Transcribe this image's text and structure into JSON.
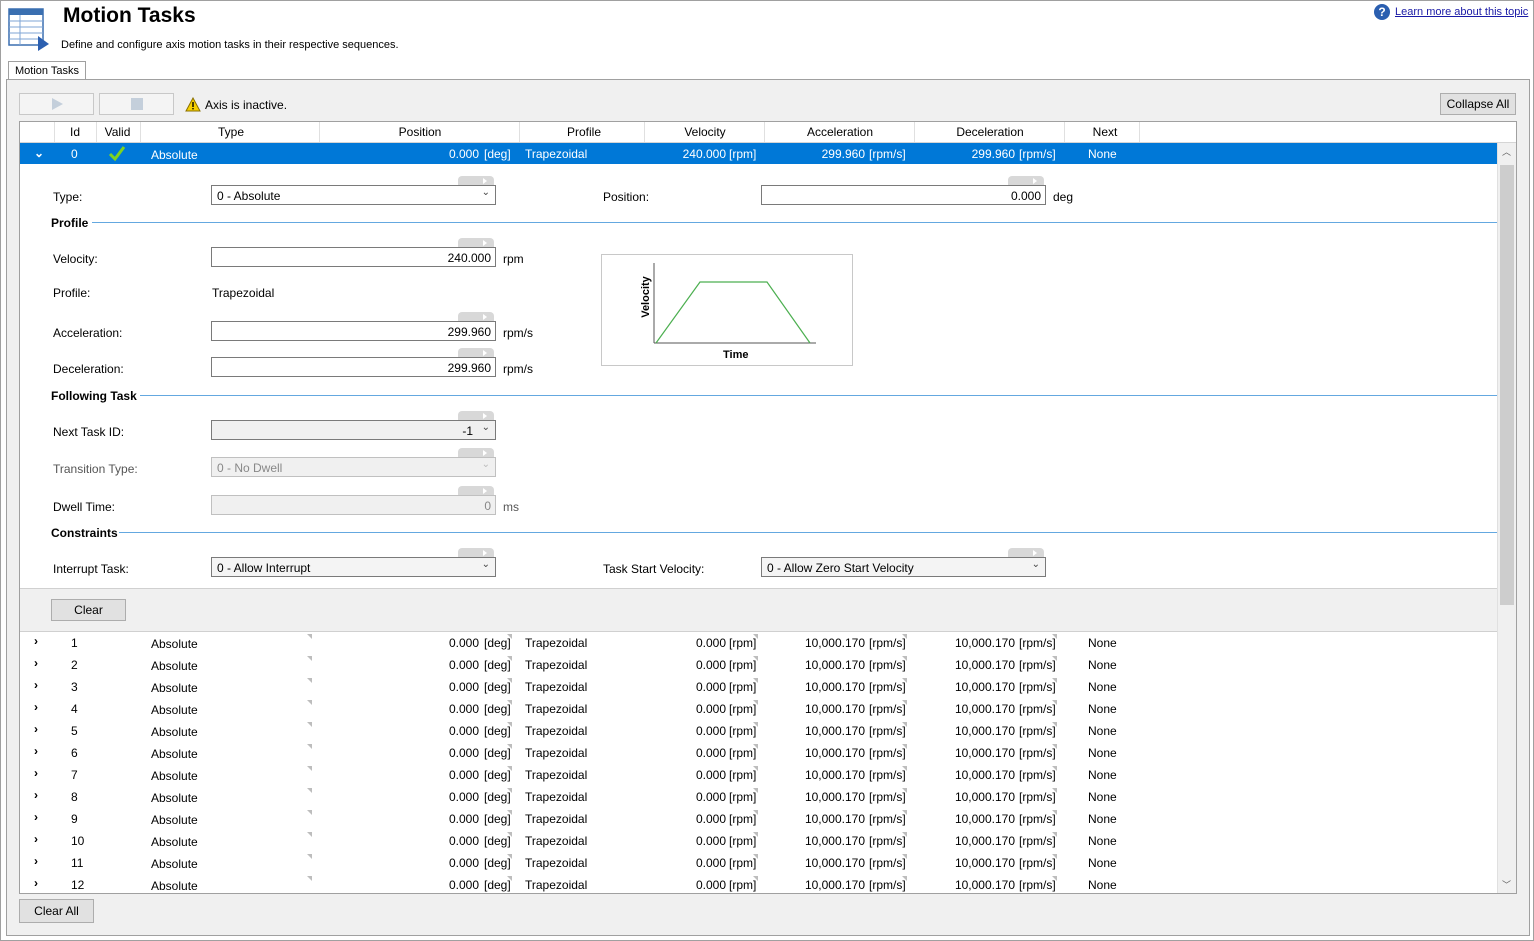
{
  "header": {
    "title": "Motion Tasks",
    "subtitle": "Define and configure axis motion tasks in their respective sequences.",
    "help_link": "Learn more about this topic"
  },
  "tabs": [
    {
      "label": "Motion Tasks"
    }
  ],
  "toolbar": {
    "status_text": "Axis is inactive.",
    "collapse_label": "Collapse All"
  },
  "grid": {
    "columns": [
      "Id",
      "Valid",
      "Type",
      "Position",
      "Profile",
      "Velocity",
      "Acceleration",
      "Deceleration",
      "Next"
    ],
    "selected_row": {
      "id": "0",
      "type": "Absolute",
      "position": "0.000",
      "position_unit": "[deg]",
      "profile": "Trapezoidal",
      "velocity": "240.000",
      "velocity_unit": "[rpm]",
      "acceleration": "299.960",
      "acceleration_unit": "[rpm/s]",
      "deceleration": "299.960",
      "deceleration_unit": "[rpm/s]",
      "next": "None"
    },
    "rows": [
      {
        "id": "1",
        "type": "Absolute",
        "position": "0.000",
        "position_unit": "[deg]",
        "profile": "Trapezoidal",
        "velocity": "0.000",
        "velocity_unit": "[rpm]",
        "acceleration": "10,000.170",
        "acceleration_unit": "[rpm/s]",
        "deceleration": "10,000.170",
        "deceleration_unit": "[rpm/s]",
        "next": "None"
      },
      {
        "id": "2",
        "type": "Absolute",
        "position": "0.000",
        "position_unit": "[deg]",
        "profile": "Trapezoidal",
        "velocity": "0.000",
        "velocity_unit": "[rpm]",
        "acceleration": "10,000.170",
        "acceleration_unit": "[rpm/s]",
        "deceleration": "10,000.170",
        "deceleration_unit": "[rpm/s]",
        "next": "None"
      },
      {
        "id": "3",
        "type": "Absolute",
        "position": "0.000",
        "position_unit": "[deg]",
        "profile": "Trapezoidal",
        "velocity": "0.000",
        "velocity_unit": "[rpm]",
        "acceleration": "10,000.170",
        "acceleration_unit": "[rpm/s]",
        "deceleration": "10,000.170",
        "deceleration_unit": "[rpm/s]",
        "next": "None"
      },
      {
        "id": "4",
        "type": "Absolute",
        "position": "0.000",
        "position_unit": "[deg]",
        "profile": "Trapezoidal",
        "velocity": "0.000",
        "velocity_unit": "[rpm]",
        "acceleration": "10,000.170",
        "acceleration_unit": "[rpm/s]",
        "deceleration": "10,000.170",
        "deceleration_unit": "[rpm/s]",
        "next": "None"
      },
      {
        "id": "5",
        "type": "Absolute",
        "position": "0.000",
        "position_unit": "[deg]",
        "profile": "Trapezoidal",
        "velocity": "0.000",
        "velocity_unit": "[rpm]",
        "acceleration": "10,000.170",
        "acceleration_unit": "[rpm/s]",
        "deceleration": "10,000.170",
        "deceleration_unit": "[rpm/s]",
        "next": "None"
      },
      {
        "id": "6",
        "type": "Absolute",
        "position": "0.000",
        "position_unit": "[deg]",
        "profile": "Trapezoidal",
        "velocity": "0.000",
        "velocity_unit": "[rpm]",
        "acceleration": "10,000.170",
        "acceleration_unit": "[rpm/s]",
        "deceleration": "10,000.170",
        "deceleration_unit": "[rpm/s]",
        "next": "None"
      },
      {
        "id": "7",
        "type": "Absolute",
        "position": "0.000",
        "position_unit": "[deg]",
        "profile": "Trapezoidal",
        "velocity": "0.000",
        "velocity_unit": "[rpm]",
        "acceleration": "10,000.170",
        "acceleration_unit": "[rpm/s]",
        "deceleration": "10,000.170",
        "deceleration_unit": "[rpm/s]",
        "next": "None"
      },
      {
        "id": "8",
        "type": "Absolute",
        "position": "0.000",
        "position_unit": "[deg]",
        "profile": "Trapezoidal",
        "velocity": "0.000",
        "velocity_unit": "[rpm]",
        "acceleration": "10,000.170",
        "acceleration_unit": "[rpm/s]",
        "deceleration": "10,000.170",
        "deceleration_unit": "[rpm/s]",
        "next": "None"
      },
      {
        "id": "9",
        "type": "Absolute",
        "position": "0.000",
        "position_unit": "[deg]",
        "profile": "Trapezoidal",
        "velocity": "0.000",
        "velocity_unit": "[rpm]",
        "acceleration": "10,000.170",
        "acceleration_unit": "[rpm/s]",
        "deceleration": "10,000.170",
        "deceleration_unit": "[rpm/s]",
        "next": "None"
      },
      {
        "id": "10",
        "type": "Absolute",
        "position": "0.000",
        "position_unit": "[deg]",
        "profile": "Trapezoidal",
        "velocity": "0.000",
        "velocity_unit": "[rpm]",
        "acceleration": "10,000.170",
        "acceleration_unit": "[rpm/s]",
        "deceleration": "10,000.170",
        "deceleration_unit": "[rpm/s]",
        "next": "None"
      },
      {
        "id": "11",
        "type": "Absolute",
        "position": "0.000",
        "position_unit": "[deg]",
        "profile": "Trapezoidal",
        "velocity": "0.000",
        "velocity_unit": "[rpm]",
        "acceleration": "10,000.170",
        "acceleration_unit": "[rpm/s]",
        "deceleration": "10,000.170",
        "deceleration_unit": "[rpm/s]",
        "next": "None"
      },
      {
        "id": "12",
        "type": "Absolute",
        "position": "0.000",
        "position_unit": "[deg]",
        "profile": "Trapezoidal",
        "velocity": "0.000",
        "velocity_unit": "[rpm]",
        "acceleration": "10,000.170",
        "acceleration_unit": "[rpm/s]",
        "deceleration": "10,000.170",
        "deceleration_unit": "[rpm/s]",
        "next": "None"
      }
    ]
  },
  "detail": {
    "type_label": "Type:",
    "type_value": "0 - Absolute",
    "position_label": "Position:",
    "position_value": "0.000",
    "position_unit": "deg",
    "profile_section": "Profile",
    "velocity_label": "Velocity:",
    "velocity_value": "240.000",
    "velocity_unit": "rpm",
    "profile_label": "Profile:",
    "profile_value": "Trapezoidal",
    "acceleration_label": "Acceleration:",
    "acceleration_value": "299.960",
    "acceleration_unit": "rpm/s",
    "deceleration_label": "Deceleration:",
    "deceleration_value": "299.960",
    "deceleration_unit": "rpm/s",
    "chart_ylabel": "Velocity",
    "chart_xlabel": "Time",
    "following_section": "Following Task",
    "next_task_label": "Next Task ID:",
    "next_task_value": "-1",
    "transition_label": "Transition Type:",
    "transition_value": "0 - No Dwell",
    "dwell_label": "Dwell Time:",
    "dwell_value": "0",
    "dwell_unit": "ms",
    "constraints_section": "Constraints",
    "interrupt_label": "Interrupt Task:",
    "interrupt_value": "0 - Allow Interrupt",
    "start_velocity_label": "Task Start Velocity:",
    "start_velocity_value": "0 - Allow Zero Start Velocity",
    "clear_label": "Clear"
  },
  "footer": {
    "clear_all_label": "Clear All"
  },
  "colors": {
    "selection": "#0078d7",
    "section_line": "#64a8e0",
    "profile_line": "#4caf50",
    "help_icon": "#2b5fb0"
  }
}
